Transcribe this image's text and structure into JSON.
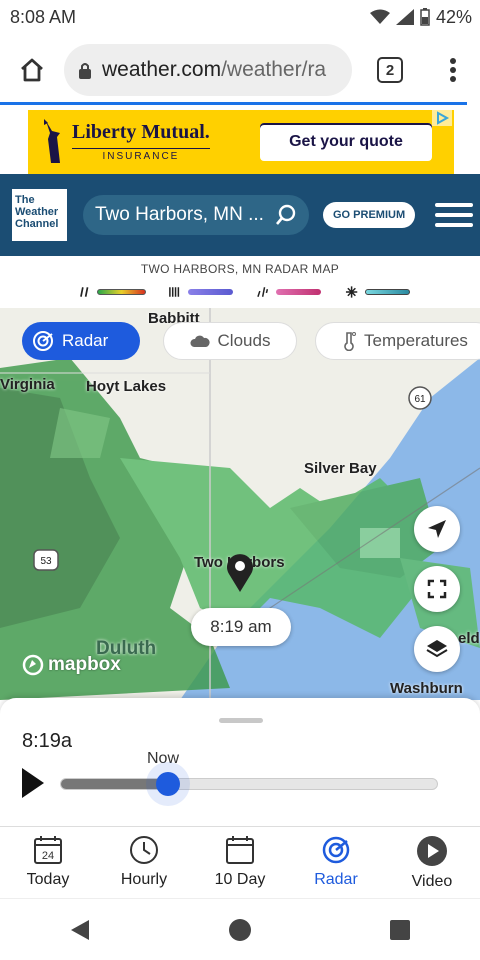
{
  "status": {
    "time": "8:08 AM",
    "battery": "42%"
  },
  "browser": {
    "url_host": "weather.com",
    "url_path": "/weather/ra",
    "tab_count": "2"
  },
  "ad": {
    "brand": "Liberty Mutual.",
    "brand_sub": "INSURANCE",
    "cta": "Get your quote"
  },
  "header": {
    "logo_lines": [
      "The",
      "Weather",
      "Channel"
    ],
    "location": "Two Harbors, MN ...",
    "premium": "GO PREMIUM"
  },
  "map": {
    "title": "TWO HARBORS, MN RADAR MAP",
    "tabs": [
      "Radar",
      "Clouds",
      "Temperatures"
    ],
    "places": [
      "Babbitt",
      "Virginia",
      "Hoyt Lakes",
      "Silver Bay",
      "Two Harbors",
      "Duluth",
      "Washburn",
      "eld"
    ],
    "highway_61": "61",
    "highway_53": "53",
    "time_tip": "8:19 am",
    "attribution": "mapbox"
  },
  "timeline": {
    "current_time": "8:19a",
    "now_label": "Now",
    "progress": 0.29
  },
  "nav": [
    "Today",
    "Hourly",
    "10 Day",
    "Radar",
    "Video"
  ],
  "nav_today_day": "24",
  "colors": {
    "accent": "#1e5bdd",
    "header_bg": "#1b4d73",
    "ad_bg": "#ffd000",
    "radar_green": "#2a9d3a"
  }
}
